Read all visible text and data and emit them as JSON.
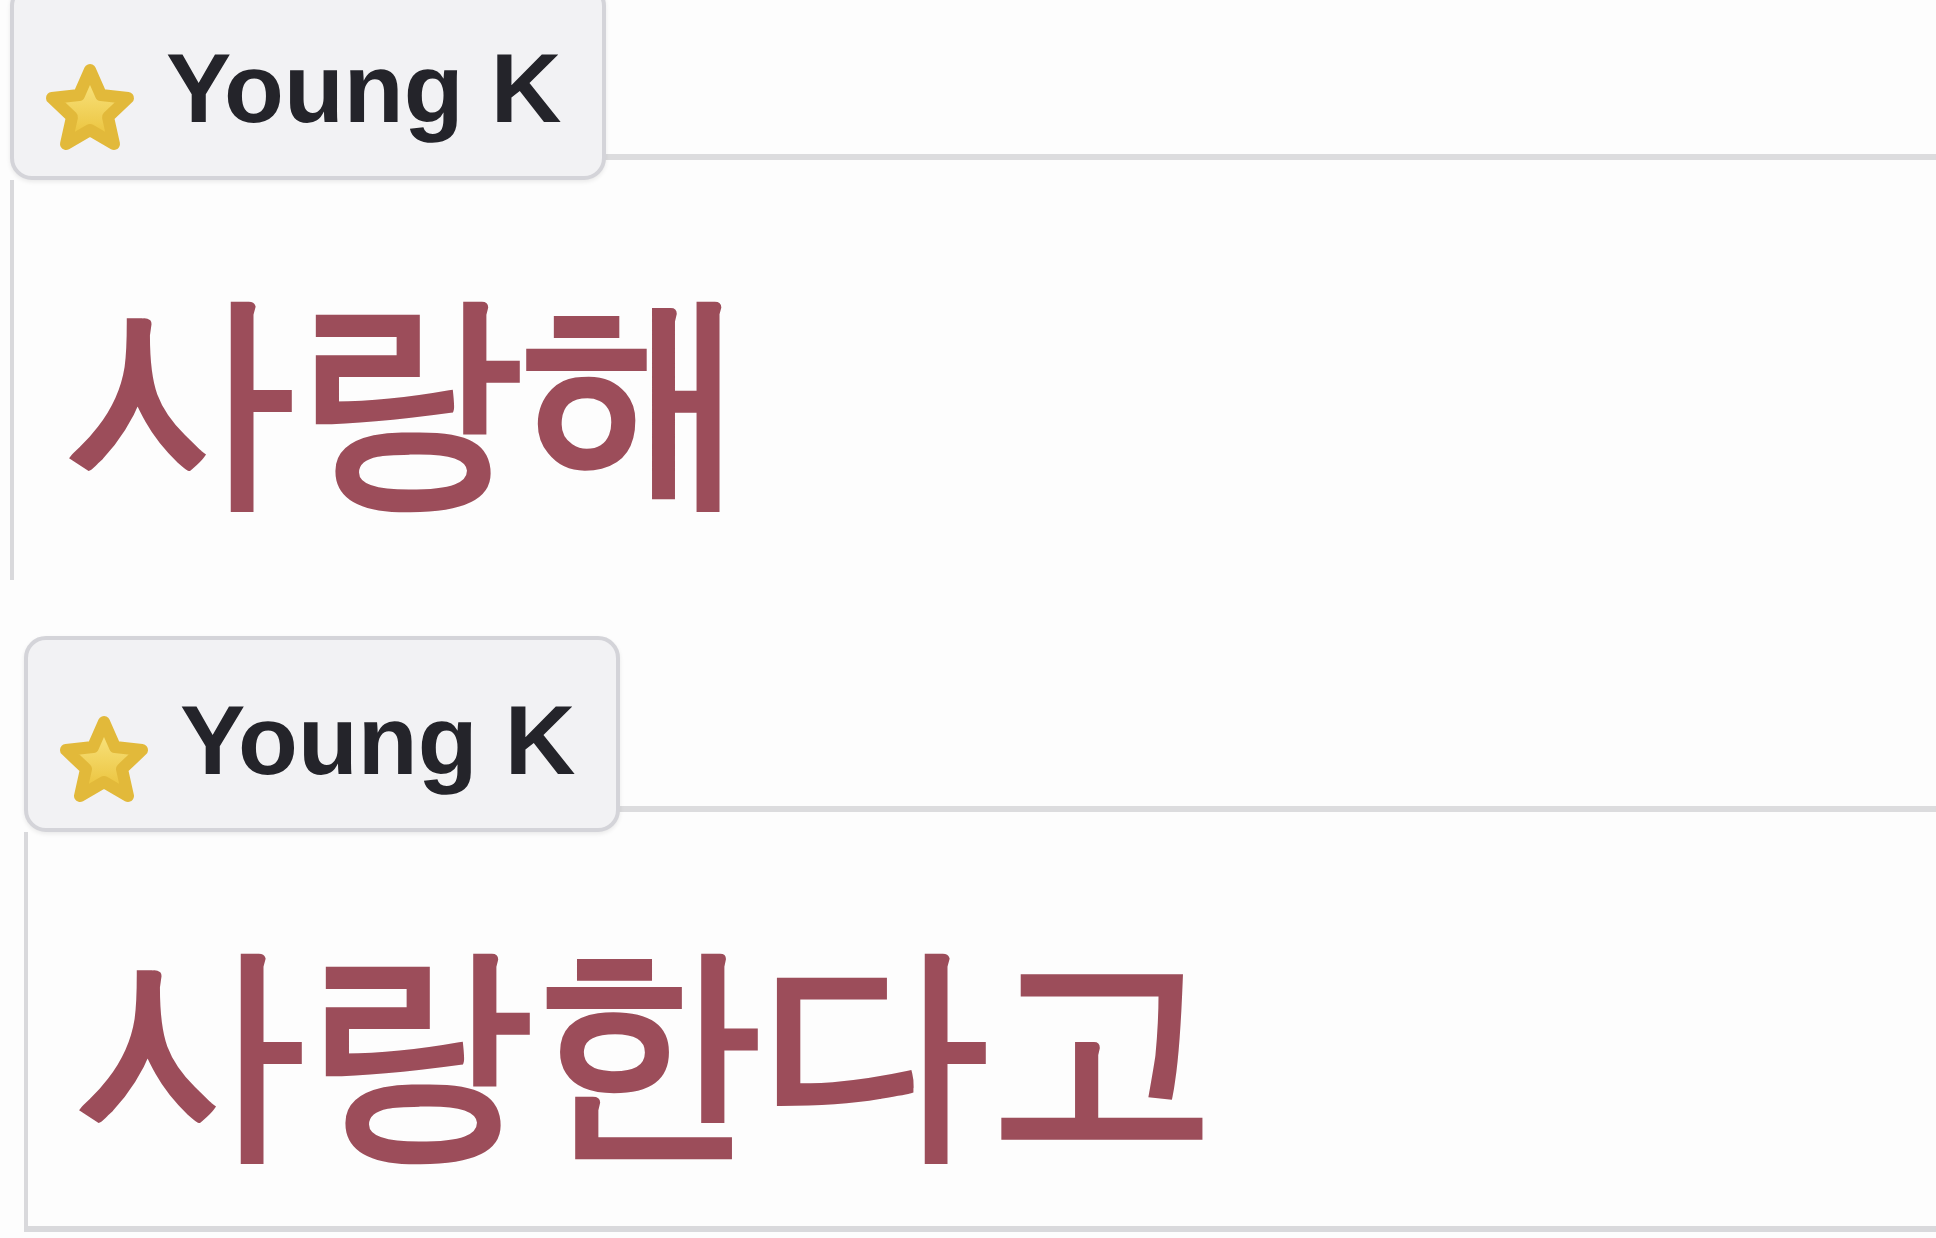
{
  "messages": [
    {
      "author": "Young K",
      "text": "사랑해"
    },
    {
      "author": "Young K",
      "text": "사랑한다고"
    }
  ]
}
